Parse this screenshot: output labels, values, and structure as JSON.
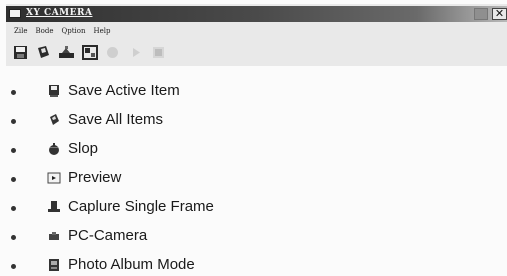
{
  "window": {
    "title": "XY CAMERA",
    "close_glyph": "✕",
    "menu": [
      "Zile",
      "Bode",
      "Qption",
      "Help"
    ]
  },
  "toolbar": {
    "buttons": [
      {
        "icon": "save-icon"
      },
      {
        "icon": "save-all-icon"
      },
      {
        "icon": "capture-icon"
      },
      {
        "icon": "preview-icon"
      },
      {
        "icon": "stop-icon"
      },
      {
        "icon": "play-icon"
      },
      {
        "icon": "photo-album-icon"
      }
    ]
  },
  "features": [
    {
      "label": "Save Active Item",
      "icon": "save-active-item-icon"
    },
    {
      "label": "Save All Items",
      "icon": "save-all-items-icon"
    },
    {
      "label": "Slop",
      "icon": "stop-icon"
    },
    {
      "label": "Preview",
      "icon": "preview-icon"
    },
    {
      "label": "Caplure Single Frame",
      "icon": "capture-frame-icon"
    },
    {
      "label": "PC-Camera",
      "icon": "pc-camera-icon"
    },
    {
      "label": "Photo Album Mode",
      "icon": "photo-album-icon"
    }
  ]
}
